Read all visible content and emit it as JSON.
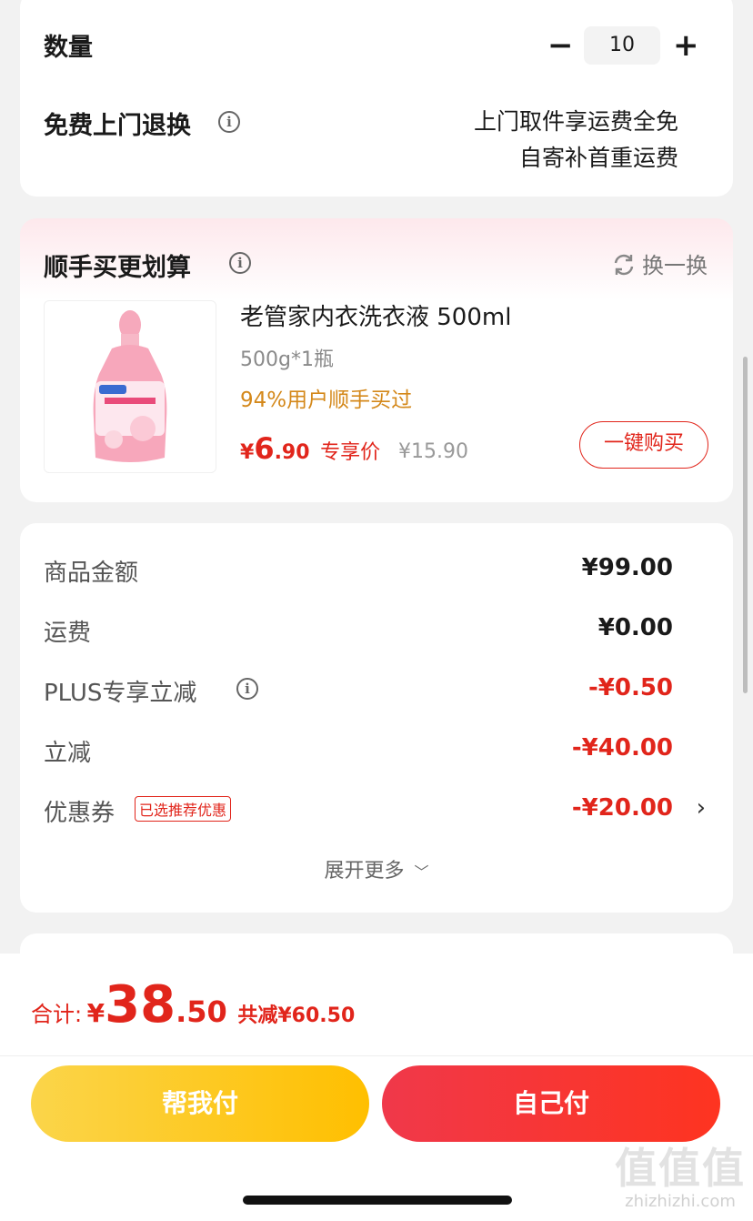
{
  "quantity": {
    "label": "数量",
    "minus": "−",
    "value": "10",
    "plus": "+"
  },
  "return_service": {
    "label": "免费上门退换",
    "line1": "上门取件享运费全免",
    "line2": "自寄补首重运费"
  },
  "addon": {
    "title": "顺手买更划算",
    "refresh_label": "换一换",
    "product": {
      "name": "老管家内衣洗衣液 500ml",
      "spec": "500g*1瓶",
      "popularity": "94%用户顺手买过",
      "price_symbol": "¥",
      "price_int": "6",
      "price_dec": ".90",
      "price_tag": "专享价",
      "original_price": "¥15.90",
      "buy_button": "一键购买"
    }
  },
  "summary": {
    "rows": [
      {
        "label": "商品金额",
        "value": "¥99.00"
      },
      {
        "label": "运费",
        "value": "¥0.00"
      },
      {
        "label": "PLUS专享立减",
        "value": "-¥0.50"
      },
      {
        "label": "立减",
        "value": "-¥40.00"
      },
      {
        "label": "优惠券",
        "tag": "已选推荐优惠",
        "value": "-¥20.00"
      }
    ],
    "expand_label": "展开更多"
  },
  "footer": {
    "total_label": "合计:",
    "total_symbol": "¥",
    "total_int": "38",
    "total_dec": ".50",
    "saved": "共减¥60.50",
    "help_pay": "帮我付",
    "self_pay": "自己付"
  },
  "watermark": {
    "text": "值值值",
    "url_text": "zhizhizhi.com"
  },
  "colors": {
    "accent_red": "#e1251b",
    "gold": "#d4881a",
    "help_pay_gradient": [
      "#fbd54a",
      "#ffbf00"
    ],
    "self_pay_gradient": [
      "#f0384a",
      "#fe3420"
    ]
  }
}
